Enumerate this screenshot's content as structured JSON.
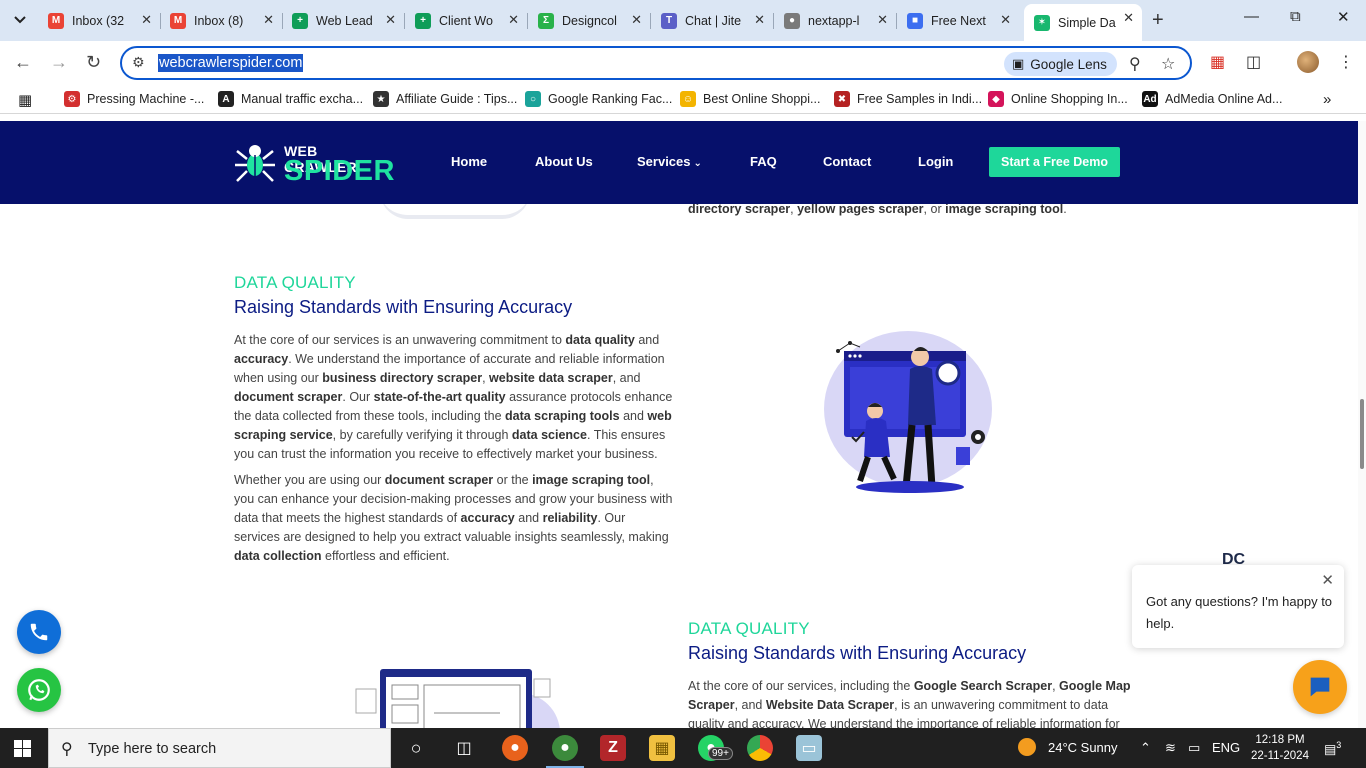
{
  "browser": {
    "tabs": [
      {
        "title": "Inbox (32",
        "icon": "gmail-icon",
        "color": "#ea4335",
        "glyph": "M"
      },
      {
        "title": "Inbox (8)",
        "icon": "gmail-icon",
        "color": "#ea4335",
        "glyph": "M"
      },
      {
        "title": "Web Lead",
        "icon": "sheets-icon",
        "color": "#0f9d58",
        "glyph": "+"
      },
      {
        "title": "Client Wo",
        "icon": "sheets-icon",
        "color": "#0f9d58",
        "glyph": "+"
      },
      {
        "title": "Designcol",
        "icon": "designcol-icon",
        "color": "#29b24a",
        "glyph": "Σ"
      },
      {
        "title": "Chat | Jite",
        "icon": "teams-icon",
        "color": "#5b5fc7",
        "glyph": "T"
      },
      {
        "title": "nextapp-l",
        "icon": "globe-icon",
        "color": "#7a7a7a",
        "glyph": "●"
      },
      {
        "title": "Free Next",
        "icon": "doc-icon",
        "color": "#3c6ef0",
        "glyph": "■"
      },
      {
        "title": "Simple Da",
        "icon": "spider-icon",
        "color": "#18b76e",
        "glyph": "✶"
      }
    ],
    "url": "webcrawlerspider.com",
    "lens_label": "Google Lens",
    "bookmarks": [
      {
        "label": "Pressing Machine -...",
        "color": "#d32f2f",
        "glyph": "⚙"
      },
      {
        "label": "Manual traffic excha...",
        "color": "#222222",
        "glyph": "A"
      },
      {
        "label": "Affiliate Guide : Tips...",
        "color": "#333333",
        "glyph": "★"
      },
      {
        "label": "Google Ranking Fac...",
        "color": "#1aa39a",
        "glyph": "○"
      },
      {
        "label": "Best Online Shoppi...",
        "color": "#f3b400",
        "glyph": "☺"
      },
      {
        "label": "Free Samples in Indi...",
        "color": "#b52222",
        "glyph": "✖"
      },
      {
        "label": "Online Shopping In...",
        "color": "#d4145a",
        "glyph": "◆"
      },
      {
        "label": "AdMedia Online Ad...",
        "color": "#111111",
        "glyph": "Ad"
      }
    ]
  },
  "site": {
    "logo_top": "WEB CRAWLER",
    "logo_bottom": "SPIDER",
    "nav": {
      "home": "Home",
      "about": "About Us",
      "services": "Services",
      "faq": "FAQ",
      "contact": "Contact",
      "login": "Login",
      "cta": "Start a Free Demo"
    },
    "top_cut": {
      "b1": "directory scraper",
      "t1": ", ",
      "b2": "yellow pages scraper",
      "t2": ", or ",
      "b3": "image scraping tool",
      "t3": "."
    },
    "section1": {
      "eyebrow": "DATA QUALITY",
      "heading": "Raising Standards with Ensuring Accuracy",
      "p1": [
        {
          "t": "At the core of our services is an unwavering commitment to "
        },
        {
          "b": "data quality"
        },
        {
          "t": " and "
        },
        {
          "b": "accuracy"
        },
        {
          "t": ". We understand the importance of accurate and reliable information when using our "
        },
        {
          "b": "business directory scraper"
        },
        {
          "t": ", "
        },
        {
          "b": "website data scraper"
        },
        {
          "t": ", and "
        },
        {
          "b": "document scraper"
        },
        {
          "t": ". Our "
        },
        {
          "b": "state-of-the-art quality"
        },
        {
          "t": " assurance protocols enhance the data collected from these tools, including the "
        },
        {
          "b": "data scraping tools"
        },
        {
          "t": " and "
        },
        {
          "b": "web scraping service"
        },
        {
          "t": ", by carefully verifying it through "
        },
        {
          "b": "data science"
        },
        {
          "t": ". This ensures you can trust the information you receive to effectively market your business."
        }
      ],
      "p2": [
        {
          "t": "Whether you are using our "
        },
        {
          "b": "document scraper"
        },
        {
          "t": " or the "
        },
        {
          "b": "image scraping tool"
        },
        {
          "t": ", you can enhance your decision-making processes and grow your business with data that meets the highest standards of "
        },
        {
          "b": "accuracy"
        },
        {
          "t": " and "
        },
        {
          "b": "reliability"
        },
        {
          "t": ". Our services are designed to help you extract valuable insights seamlessly, making "
        },
        {
          "b": "data collection"
        },
        {
          "t": " effortless and efficient."
        }
      ]
    },
    "section2": {
      "eyebrow": "DATA QUALITY",
      "heading": "Raising Standards with Ensuring Accuracy",
      "p1": [
        {
          "t": "At the core of our services, including the "
        },
        {
          "b": "Google Search Scraper"
        },
        {
          "t": ", "
        },
        {
          "b": "Google Map Scraper"
        },
        {
          "t": ", and "
        },
        {
          "b": "Website Data Scraper"
        },
        {
          "t": ", is an unwavering commitment to data quality and accuracy. We understand the importance of reliable information for"
        }
      ]
    },
    "chat": {
      "logo": "DC",
      "message": "Got any questions? I'm happy to help."
    }
  },
  "taskbar": {
    "search_placeholder": "Type here to search",
    "whatsapp_badge": "99+",
    "weather": "24°C  Sunny",
    "language": "ENG",
    "time": "12:18 PM",
    "date": "22-11-2024",
    "notifications": "3"
  },
  "colors": {
    "nav_bg": "#06106b",
    "accent": "#1fd69a",
    "heading": "#0c1c84",
    "chat_orange": "#f7a11a"
  }
}
